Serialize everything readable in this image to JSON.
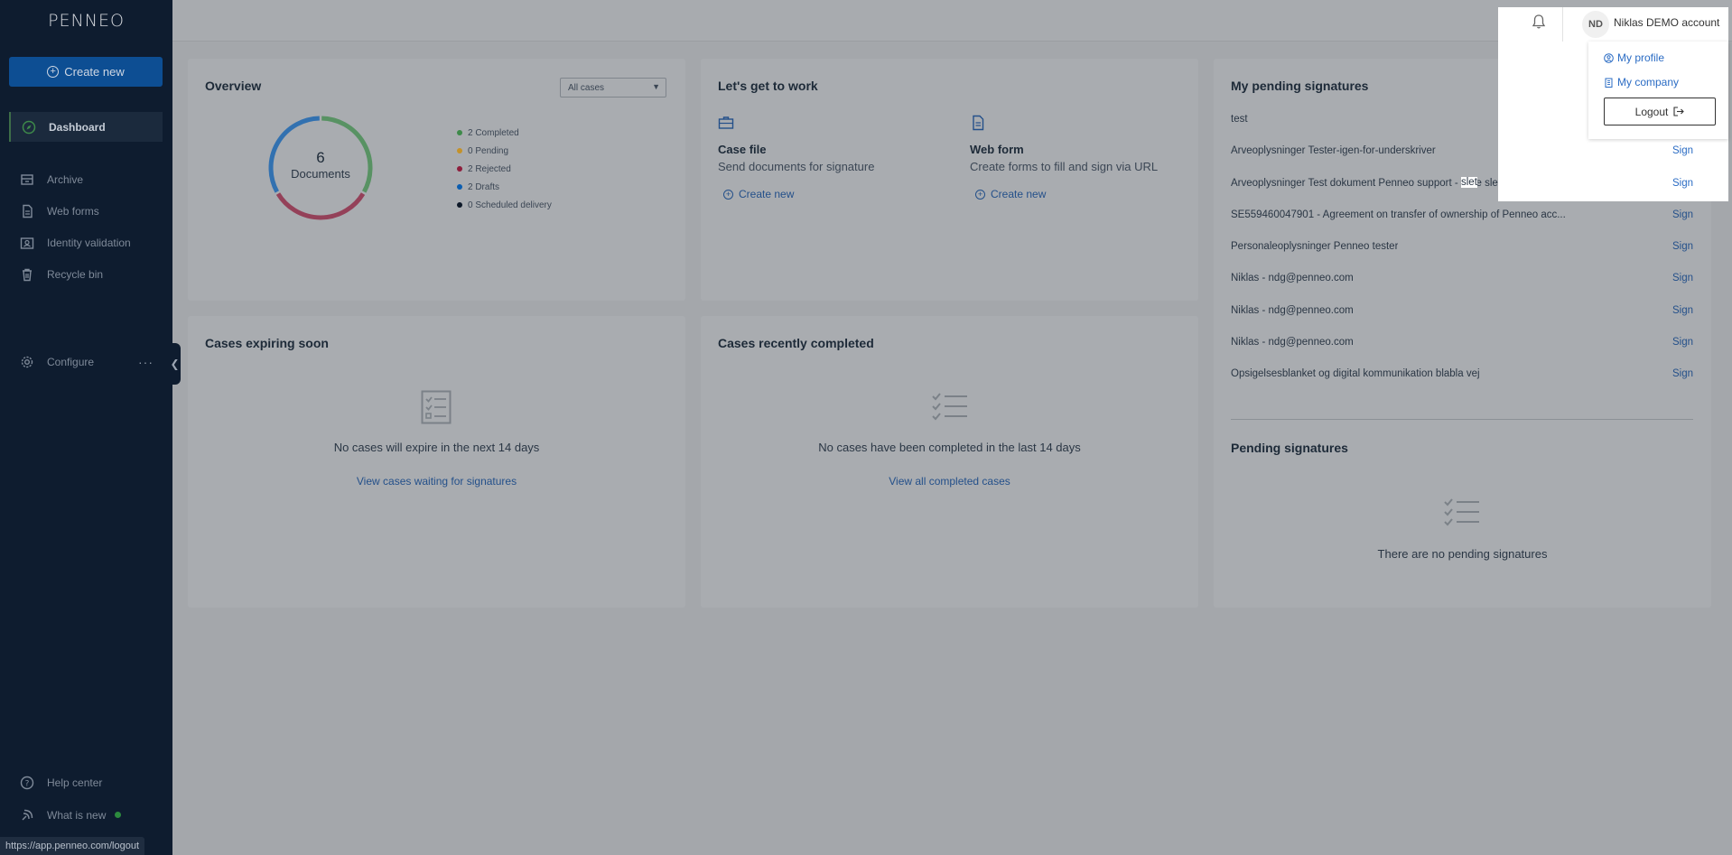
{
  "sidebar": {
    "logo": "PENNEO",
    "create_label": "Create new",
    "items": [
      {
        "label": "Dashboard"
      },
      {
        "label": "Archive"
      },
      {
        "label": "Web forms"
      },
      {
        "label": "Identity validation"
      },
      {
        "label": "Recycle bin"
      },
      {
        "label": "Configure"
      },
      {
        "label": "Help center"
      },
      {
        "label": "What is new"
      }
    ],
    "configure_more": "···"
  },
  "status_url": "https://app.penneo.com/logout",
  "overview": {
    "title": "Overview",
    "filter": "All cases",
    "total": "6",
    "total_label": "Documents",
    "legend": [
      {
        "label": "2 Completed",
        "value": 2,
        "color": "#3e8a4a"
      },
      {
        "label": "0 Pending",
        "value": 0,
        "color": "#c4922a"
      },
      {
        "label": "2 Rejected",
        "value": 2,
        "color": "#8e1e3c"
      },
      {
        "label": "2 Drafts",
        "value": 2,
        "color": "#0b5db0"
      },
      {
        "label": "0 Scheduled delivery",
        "value": 0,
        "color": "#0d1828"
      }
    ]
  },
  "work": {
    "title": "Let's get to work",
    "case_title": "Case file",
    "case_desc": "Send documents for signature",
    "case_link": "Create new",
    "form_title": "Web form",
    "form_desc": "Create forms to fill and sign via URL",
    "form_link": "Create new"
  },
  "pending": {
    "title": "My pending signatures",
    "sign_label": "Sign",
    "rows": [
      "test",
      "Arveoplysninger Tester-igen-for-underskriver",
      "Arveoplysninger Test dokument Penneo support - bare slet",
      "SE559460047901 - Agreement on transfer of ownership of Penneo acc...",
      "Personaleoplysninger Penneo tester",
      "Niklas - ndg@penneo.com",
      "Niklas - ndg@penneo.com",
      "Niklas - ndg@penneo.com",
      "Opsigelsesblanket og digital kommunikation blabla vej"
    ],
    "section2_title": "Pending signatures",
    "section2_empty": "There are no pending signatures"
  },
  "expiring": {
    "title": "Cases expiring soon",
    "empty": "No cases will expire in the next 14 days",
    "link": "View cases waiting for signatures"
  },
  "completed": {
    "title": "Cases recently completed",
    "empty": "No cases have been completed in the last 14 days",
    "link": "View all completed cases"
  },
  "user": {
    "initials": "ND",
    "account": "Niklas DEMO account",
    "menu": {
      "profile": "My profile",
      "company": "My company",
      "logout": "Logout"
    }
  }
}
